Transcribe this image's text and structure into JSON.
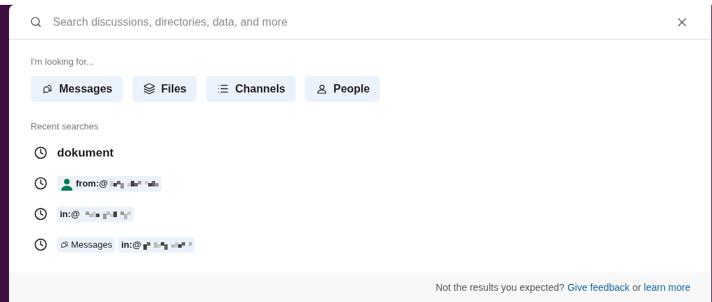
{
  "search": {
    "placeholder": "Search discussions, directories, data, and more"
  },
  "looking_for": {
    "heading": "I'm looking for...",
    "options": [
      {
        "kind": "messages",
        "label": "Messages"
      },
      {
        "kind": "files",
        "label": "Files"
      },
      {
        "kind": "channels",
        "label": "Channels"
      },
      {
        "kind": "people",
        "label": "People"
      }
    ]
  },
  "recent": {
    "heading": "Recent searches",
    "items": [
      {
        "kind": "query",
        "text": "dokument"
      },
      {
        "kind": "filters",
        "filters": [
          {
            "kind": "user",
            "label": "from:@"
          }
        ]
      },
      {
        "kind": "filters",
        "filters": [
          {
            "kind": "plain",
            "label": "in:@"
          }
        ]
      },
      {
        "kind": "filters",
        "filters": [
          {
            "kind": "messages",
            "label": "Messages"
          },
          {
            "kind": "plain",
            "label": "in:@"
          }
        ]
      }
    ]
  },
  "footer": {
    "text": "Not the results you expected?",
    "feedback_link": "Give feedback",
    "joiner": "or",
    "learn_link": "learn more"
  }
}
